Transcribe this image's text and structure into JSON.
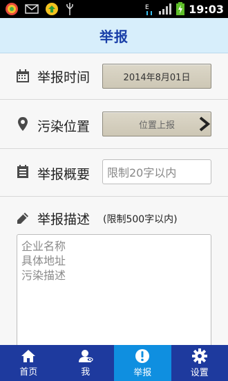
{
  "status_bar": {
    "time": "19:03",
    "icons": [
      "app-icon",
      "mail-icon",
      "sync-icon",
      "usb-icon",
      "data-icon",
      "signal-icon",
      "battery-icon"
    ]
  },
  "header": {
    "title": "举报"
  },
  "form": {
    "time": {
      "label": "举报时间",
      "value": "2014年8月01日"
    },
    "location": {
      "label": "污染位置",
      "button": "位置上报"
    },
    "summary": {
      "label": "举报概要",
      "placeholder": "限制20字以内"
    },
    "description": {
      "label": "举报描述",
      "hint": "(限制500字以内)",
      "placeholder_lines": [
        "企业名称",
        "具体地址",
        "污染描述"
      ]
    }
  },
  "tabs": [
    {
      "label": "首页",
      "icon": "home-icon",
      "active": false
    },
    {
      "label": "我",
      "icon": "user-icon",
      "active": false
    },
    {
      "label": "举报",
      "icon": "alert-icon",
      "active": true
    },
    {
      "label": "设置",
      "icon": "gear-icon",
      "active": false
    }
  ],
  "colors": {
    "header_bg": "#d7eefb",
    "title": "#1a3fa8",
    "tabbar": "#1e3a9e",
    "tab_active": "#0f8fe0"
  }
}
